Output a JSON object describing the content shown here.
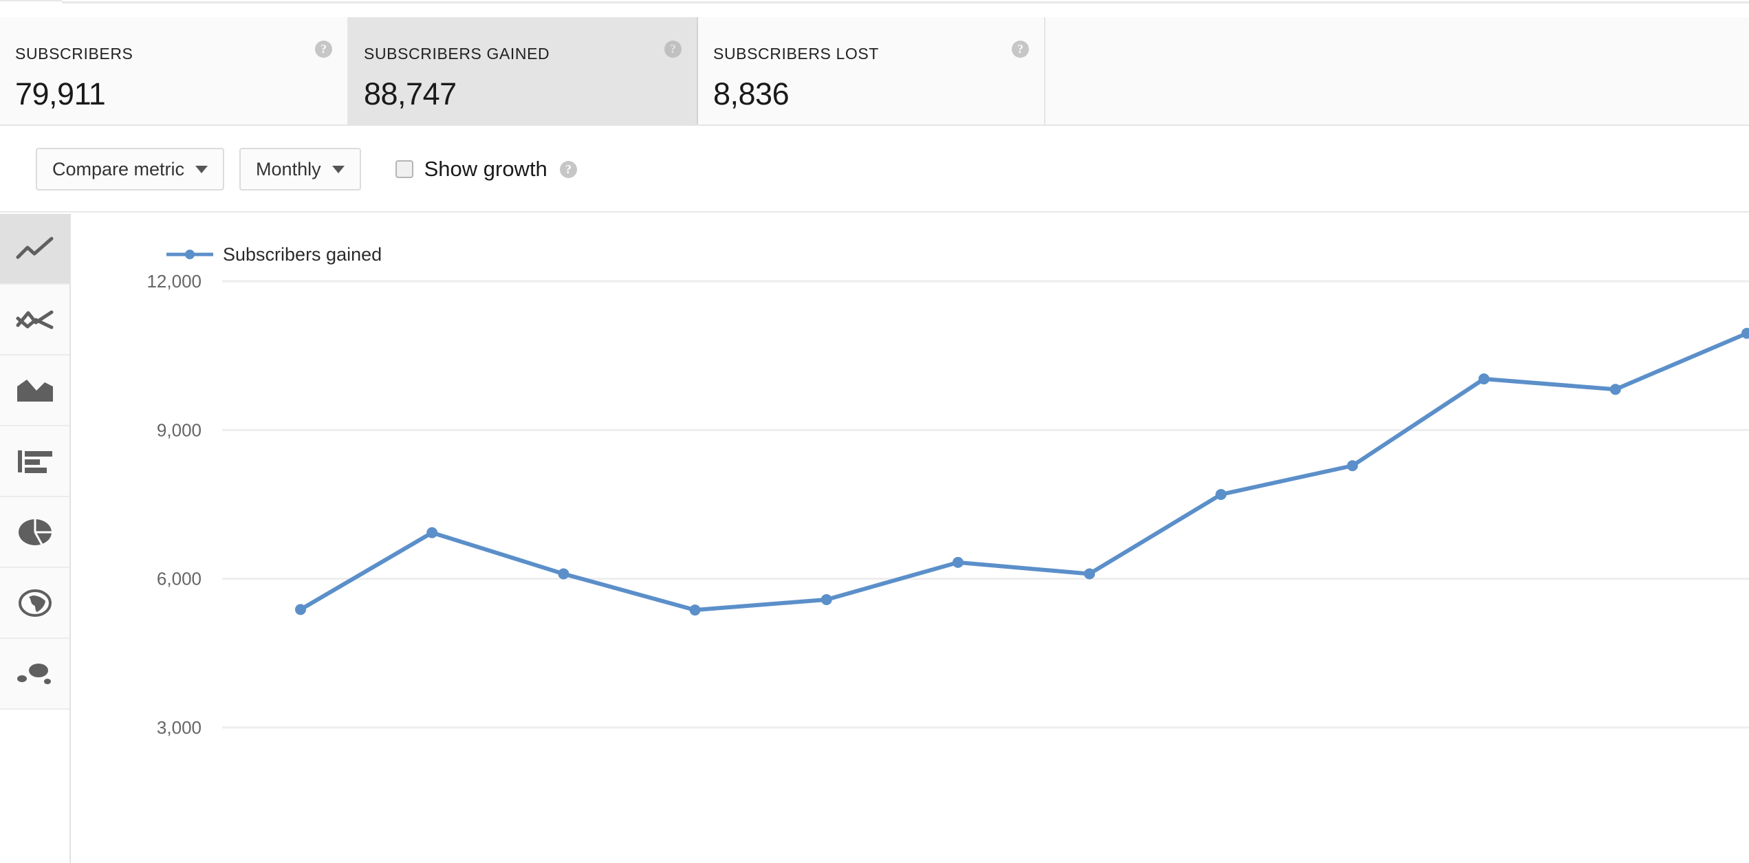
{
  "metric_cards": [
    {
      "label": "SUBSCRIBERS",
      "value": "79,911",
      "help_glyph": "?",
      "selected": false
    },
    {
      "label": "SUBSCRIBERS GAINED",
      "value": "88,747",
      "help_glyph": "?",
      "selected": true
    },
    {
      "label": "SUBSCRIBERS LOST",
      "value": "8,836",
      "help_glyph": "?",
      "selected": false
    }
  ],
  "toolbar": {
    "compare_metric_label": "Compare metric",
    "period_label": "Monthly",
    "show_growth_label": "Show growth",
    "show_growth_checked": false,
    "help_glyph": "?"
  },
  "sidebar": {
    "items": [
      {
        "icon": "line-chart-icon",
        "selected": true
      },
      {
        "icon": "multi-line-chart-icon",
        "selected": false
      },
      {
        "icon": "area-chart-icon",
        "selected": false
      },
      {
        "icon": "bar-chart-icon",
        "selected": false
      },
      {
        "icon": "pie-chart-icon",
        "selected": false
      },
      {
        "icon": "geography-globe-icon",
        "selected": false
      },
      {
        "icon": "bubble-chart-icon",
        "selected": false
      }
    ]
  },
  "chart_data": {
    "type": "line",
    "title": "",
    "xlabel": "",
    "ylabel": "",
    "legend_position": "top-left",
    "grid": true,
    "line_color": "#5b8fc9",
    "marker_color": "#5b8fc9",
    "yticks": [
      "12,000",
      "9,000",
      "6,000",
      "3,000"
    ],
    "ytick_values": [
      12000,
      9000,
      6000,
      3000
    ],
    "ylim": [
      1700,
      13000
    ],
    "x": [
      1,
      2,
      3,
      4,
      5,
      6,
      7,
      8,
      9,
      10,
      11,
      12
    ],
    "series": [
      {
        "name": "Subscribers gained",
        "values": [
          5380,
          6930,
          6100,
          5370,
          5580,
          6330,
          6100,
          7700,
          8280,
          10030,
          9820,
          10950
        ]
      }
    ]
  }
}
